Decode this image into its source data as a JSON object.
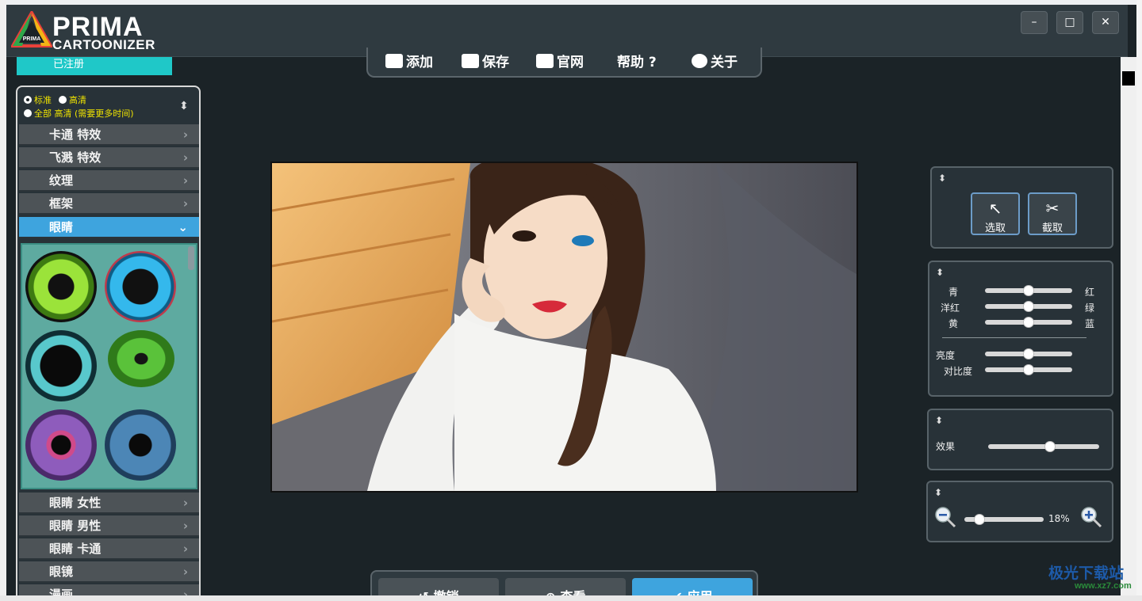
{
  "app": {
    "logo_line1": "PRIMA",
    "logo_line2": "CARTOONIZER",
    "logo_badge": "PRIMA",
    "window_buttons": [
      "minimize",
      "maximize",
      "close"
    ]
  },
  "registration": {
    "label": "已注册"
  },
  "toolbar": {
    "items": [
      {
        "label": "添加",
        "icon": "add-image-icon"
      },
      {
        "label": "保存",
        "icon": "save-icon"
      },
      {
        "label": "官网",
        "icon": "website-icon"
      },
      {
        "label": "帮助 ?",
        "icon": "help-icon"
      },
      {
        "label": "关于",
        "icon": "info-icon"
      }
    ]
  },
  "quality": {
    "standard": "标准",
    "hd": "高清",
    "all_hd": "全部 高清 (需要更多时间)",
    "selected": "标准"
  },
  "categories": [
    {
      "label": "卡通 特效"
    },
    {
      "label": "飞溅 特效"
    },
    {
      "label": "纹理"
    },
    {
      "label": "框架"
    },
    {
      "label": "眼睛",
      "expanded": true
    },
    {
      "label": "眼睛 女性"
    },
    {
      "label": "眼睛 男性"
    },
    {
      "label": "眼睛 卡通"
    },
    {
      "label": "眼镜"
    },
    {
      "label": "漫画"
    }
  ],
  "eye_thumbnails": [
    {
      "name": "green-cat-eye",
      "color": "#7ac02a"
    },
    {
      "name": "blue-glossy-eye",
      "color": "#2aa6d8"
    },
    {
      "name": "teal-dark-eye",
      "color": "#3ab4b8"
    },
    {
      "name": "green-reptile-eye",
      "color": "#4caa2a"
    },
    {
      "name": "purple-iris-eye",
      "color": "#8a4aa8"
    },
    {
      "name": "blue-iris-eye",
      "color": "#3a6ea0"
    }
  ],
  "select_panel": {
    "select_label": "选取",
    "crop_label": "截取"
  },
  "color_panel": {
    "rows": [
      {
        "left": "青",
        "right": "红",
        "value": 50
      },
      {
        "left": "洋红",
        "right": "绿",
        "value": 50
      },
      {
        "left": "黄",
        "right": "蓝",
        "value": 50
      }
    ],
    "brightness_label": "亮度",
    "brightness_value": 50,
    "contrast_label": "对比度",
    "contrast_value": 50
  },
  "effect_panel": {
    "label": "效果",
    "value": 55
  },
  "zoom_panel": {
    "value": 18,
    "value_text": "18%"
  },
  "bottom_toolbar": {
    "undo_label": "撤销",
    "view_label": "查看",
    "apply_label": "应用"
  },
  "watermark": {
    "line1": "极光下载站",
    "line2": "www.xz7.com"
  },
  "colors": {
    "accent_blue": "#3ea4de",
    "accent_cyan": "#1fc8c8",
    "quality_text": "#f0e400",
    "panel_bg": "#283238"
  }
}
